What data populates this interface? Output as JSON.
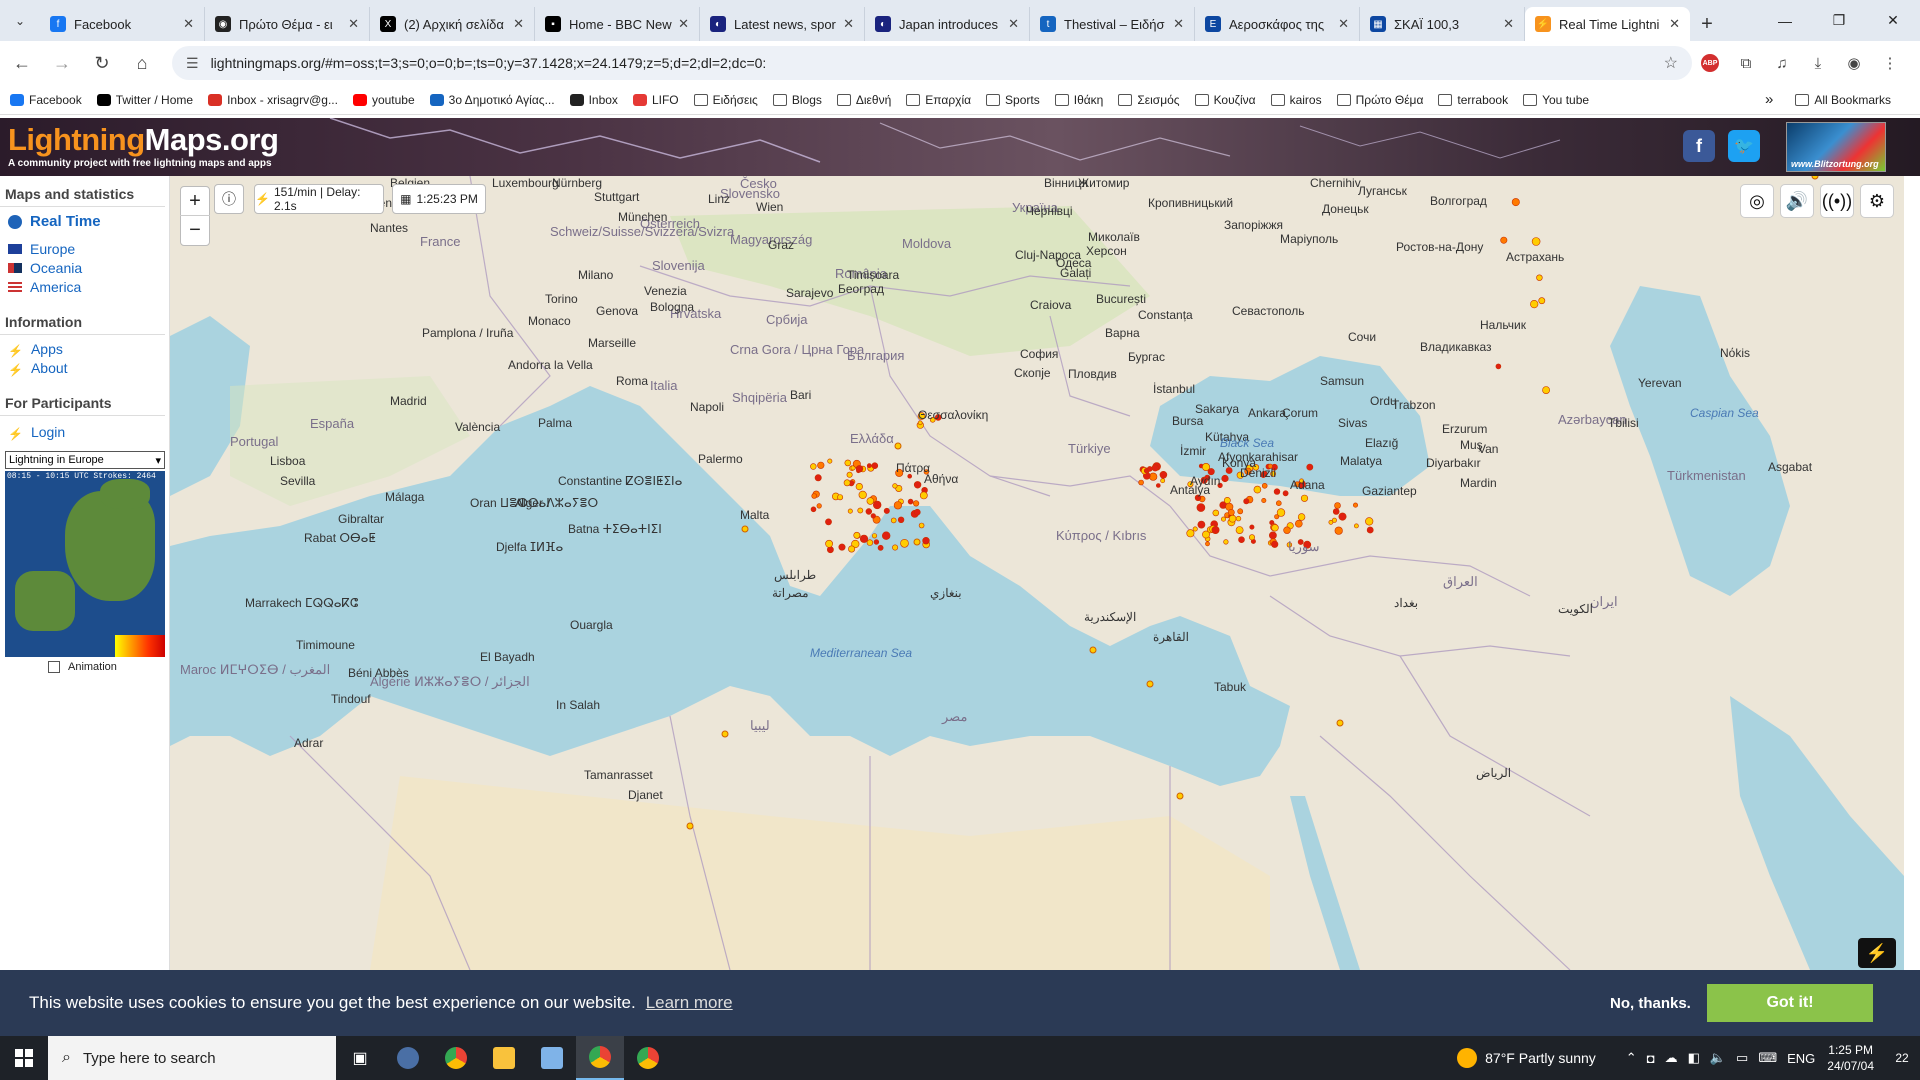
{
  "browser": {
    "tabs": [
      {
        "title": "Facebook",
        "color": "#1877f2",
        "glyph": "f"
      },
      {
        "title": "Πρώτο Θέμα - ει",
        "color": "#222222",
        "glyph": "◉"
      },
      {
        "title": "(2) Αρχική σελίδα",
        "color": "#000000",
        "glyph": "X"
      },
      {
        "title": "Home - BBC New",
        "color": "#000000",
        "glyph": "▪"
      },
      {
        "title": "Latest news, spor",
        "color": "#1a237e",
        "glyph": "◐"
      },
      {
        "title": "Japan introduces",
        "color": "#1a237e",
        "glyph": "◐"
      },
      {
        "title": "Thestival – Ειδήσ",
        "color": "#1565c0",
        "glyph": "t"
      },
      {
        "title": "Αεροσκάφος της",
        "color": "#0d47a1",
        "glyph": "E"
      },
      {
        "title": "ΣΚΑΪ 100,3",
        "color": "#0d47a1",
        "glyph": "▦"
      },
      {
        "title": "Real Time Lightni",
        "color": "#f7931e",
        "glyph": "⚡",
        "active": true
      }
    ],
    "url": "lightningmaps.org/#m=oss;t=3;s=0;o=0;b=;ts=0;y=37.1428;x=24.1479;z=5;d=2;dl=2;dc=0:",
    "bookmarks": [
      {
        "label": "Facebook",
        "type": "site",
        "color": "#1877f2"
      },
      {
        "label": "Twitter / Home",
        "type": "site",
        "color": "#000000"
      },
      {
        "label": "Inbox - xrisagrv@g...",
        "type": "site",
        "color": "#d93025"
      },
      {
        "label": "youtube",
        "type": "site",
        "color": "#ff0000"
      },
      {
        "label": "3ο Δημοτικό Αγίας...",
        "type": "site",
        "color": "#1565c0"
      },
      {
        "label": "Inbox",
        "type": "site",
        "color": "#222222"
      },
      {
        "label": "LIFO",
        "type": "site",
        "color": "#e53935"
      },
      {
        "label": "Ειδήσεις",
        "type": "folder"
      },
      {
        "label": "Blogs",
        "type": "folder"
      },
      {
        "label": "Διεθνή",
        "type": "folder"
      },
      {
        "label": "Επαρχία",
        "type": "folder"
      },
      {
        "label": "Sports",
        "type": "folder"
      },
      {
        "label": "Ιθάκη",
        "type": "folder"
      },
      {
        "label": "Σεισμός",
        "type": "folder"
      },
      {
        "label": "Κουζίνα",
        "type": "folder"
      },
      {
        "label": "kairos",
        "type": "folder"
      },
      {
        "label": "Πρώτο Θέμα",
        "type": "folder"
      },
      {
        "label": "terrabook",
        "type": "folder"
      },
      {
        "label": "You tube",
        "type": "folder"
      }
    ],
    "all_bookmarks": "All Bookmarks",
    "more": "»"
  },
  "site": {
    "logo_lightning": "Lightning",
    "logo_maps": "Maps.org",
    "tagline": "A community project with free lightning maps and apps",
    "blitz_badge": "www.Blitzortung.org"
  },
  "sidebar": {
    "maps_header": "Maps and statistics",
    "realtime": "Real Time",
    "regions": [
      "Europe",
      "Oceania",
      "America"
    ],
    "info_header": "Information",
    "info_items": [
      "Apps",
      "About"
    ],
    "participants_header": "For Participants",
    "login": "Login",
    "select_value": "Lightning in Europe",
    "mini_caption": "08:15 - 10:15 UTC Strokes: 2464",
    "animation_label": "Animation"
  },
  "map": {
    "zoom_in": "+",
    "zoom_out": "−",
    "rate": "151/min | Delay: 2.1s",
    "time": "1:25:23 PM",
    "labels_country": [
      {
        "t": "France"
      },
      {
        "t": "España"
      },
      {
        "t": "Portugal"
      },
      {
        "t": "Italia"
      },
      {
        "t": "Magyarország"
      },
      {
        "t": "România"
      },
      {
        "t": "Україна"
      },
      {
        "t": "Türkiye"
      },
      {
        "t": "Moldova"
      },
      {
        "t": "Србија"
      },
      {
        "t": "България"
      },
      {
        "t": "Ελλάδα"
      },
      {
        "t": "Slovenija"
      },
      {
        "t": "Hrvatska"
      },
      {
        "t": "Shqipëria"
      },
      {
        "t": "Crna Gora / Црна Гора"
      },
      {
        "t": "Algérie ⵍⵣⵣⴰⵢⴻⵔ / الجزائر"
      },
      {
        "t": "مصر"
      },
      {
        "t": "ليبيا"
      },
      {
        "t": "العراق"
      },
      {
        "t": "Azərbaycan"
      },
      {
        "t": "Türkmenistan"
      },
      {
        "t": "ایران"
      },
      {
        "t": "Maroc ⵍⵎⵖⵔⵉⴱ / المغرب"
      },
      {
        "t": "سوريا"
      },
      {
        "t": "Κύπρος / Kıbrıs"
      },
      {
        "t": "Österreich"
      },
      {
        "t": "Schweiz/Suisse/Svizzera/Svizra"
      },
      {
        "t": "Slovensko"
      },
      {
        "t": "Česko"
      }
    ],
    "labels_city": [
      {
        "t": "Belgien"
      },
      {
        "t": "Nürnberg"
      },
      {
        "t": "Luxembourg"
      },
      {
        "t": "Stuttgart"
      },
      {
        "t": "München"
      },
      {
        "t": "Linz"
      },
      {
        "t": "Wien"
      },
      {
        "t": "Graz"
      },
      {
        "t": "Rennes"
      },
      {
        "t": "Nantes"
      },
      {
        "t": "Milano"
      },
      {
        "t": "Torino"
      },
      {
        "t": "Venezia"
      },
      {
        "t": "Genova"
      },
      {
        "t": "Bologna"
      },
      {
        "t": "Monaco"
      },
      {
        "t": "Marseille"
      },
      {
        "t": "Pamplona / Iruña"
      },
      {
        "t": "Andorra la Vella"
      },
      {
        "t": "Madrid"
      },
      {
        "t": "València"
      },
      {
        "t": "Palma"
      },
      {
        "t": "Lisboa"
      },
      {
        "t": "Sevilla"
      },
      {
        "t": "Málaga"
      },
      {
        "t": "Gibraltar"
      },
      {
        "t": "Roma"
      },
      {
        "t": "Napoli"
      },
      {
        "t": "Bari"
      },
      {
        "t": "Palermo"
      },
      {
        "t": "Sarajevo"
      },
      {
        "t": "Београд"
      },
      {
        "t": "Timișoara"
      },
      {
        "t": "Cluj-Napoca"
      },
      {
        "t": "Craiova"
      },
      {
        "t": "București"
      },
      {
        "t": "Constanța"
      },
      {
        "t": "Варна"
      },
      {
        "t": "София"
      },
      {
        "t": "Бургас"
      },
      {
        "t": "Пловдив"
      },
      {
        "t": "Скопје"
      },
      {
        "t": "Θεσσαλονίκη"
      },
      {
        "t": "Πάτρα"
      },
      {
        "t": "Αθήνα"
      },
      {
        "t": "İstanbul"
      },
      {
        "t": "Bursa"
      },
      {
        "t": "Sakarya"
      },
      {
        "t": "Ankara"
      },
      {
        "t": "Çorum"
      },
      {
        "t": "Samsun"
      },
      {
        "t": "İzmir"
      },
      {
        "t": "Kütahya"
      },
      {
        "t": "Afyonkarahisar"
      },
      {
        "t": "Konya"
      },
      {
        "t": "Denizli"
      },
      {
        "t": "Aydın"
      },
      {
        "t": "Antalya"
      },
      {
        "t": "Adana"
      },
      {
        "t": "Gaziantep"
      },
      {
        "t": "Malatya"
      },
      {
        "t": "Elazığ"
      },
      {
        "t": "Sivas"
      },
      {
        "t": "Ordu"
      },
      {
        "t": "Trabzon"
      },
      {
        "t": "Erzurum"
      },
      {
        "t": "Muş"
      },
      {
        "t": "Van"
      },
      {
        "t": "Diyarbakır"
      },
      {
        "t": "Mardin"
      },
      {
        "t": "Одеса"
      },
      {
        "t": "Миколаїв"
      },
      {
        "t": "Херсон"
      },
      {
        "t": "Запоріжжя"
      },
      {
        "t": "Маріуполь"
      },
      {
        "t": "Донецьк"
      },
      {
        "t": "Луганськ"
      },
      {
        "t": "Волгоград"
      },
      {
        "t": "Ростов-на-Дону"
      },
      {
        "t": "Астрахань"
      },
      {
        "t": "Севастополь"
      },
      {
        "t": "Сочи"
      },
      {
        "t": "Нальчик"
      },
      {
        "t": "Владикавказ"
      },
      {
        "t": "Кропивницький"
      },
      {
        "t": "Житомир"
      },
      {
        "t": "Вінниця"
      },
      {
        "t": "Чернівці"
      },
      {
        "t": "Galați"
      },
      {
        "t": "Chernihiv"
      },
      {
        "t": "Oran ⵡⴻⵀⵔⴰⵏ"
      },
      {
        "t": "Alger ⴷⵣⴰⵢⴻⵔ"
      },
      {
        "t": "Constantine ⵇⵙⴻⵏⵟⵉⵏⴰ"
      },
      {
        "t": "Batna ⵜⵉⴱⴰⵜⵏⵉⵏ"
      },
      {
        "t": "Djelfa ⵊⵍⴼⴰ"
      },
      {
        "t": "Rabat ⵔⴱⴰⵟ"
      },
      {
        "t": "Marrakech ⵎⵕⵕⴰⴽⵛ"
      },
      {
        "t": "Malta"
      },
      {
        "t": "بنغازي"
      },
      {
        "t": "طرابلس"
      },
      {
        "t": "مصراتة"
      },
      {
        "t": "الإسكندرية"
      },
      {
        "t": "القاهرة"
      },
      {
        "t": "Nόkis"
      },
      {
        "t": "Asgabat"
      },
      {
        "t": "Tbilisi"
      },
      {
        "t": "Yerevan"
      },
      {
        "t": "بغداد"
      },
      {
        "t": "الكويت"
      },
      {
        "t": "الرياض"
      },
      {
        "t": "Tabuk"
      },
      {
        "t": "In Salah"
      },
      {
        "t": "Ouargla"
      },
      {
        "t": "El Bayadh"
      },
      {
        "t": "Béni Abbès"
      },
      {
        "t": "Tamanrasset"
      },
      {
        "t": "Djanet"
      },
      {
        "t": "Tindouf"
      },
      {
        "t": "Adrar"
      },
      {
        "t": "Timimoune"
      }
    ],
    "labels_sea": [
      {
        "t": "Mediterranean Sea"
      },
      {
        "t": "Black Sea"
      },
      {
        "t": "Caspian Sea"
      }
    ]
  },
  "cookie": {
    "message": "This website uses cookies to ensure you get the best experience on our website.",
    "learn_more": "Learn more",
    "decline": "No, thanks.",
    "accept": "Got it!"
  },
  "taskbar": {
    "search_placeholder": "Type here to search",
    "weather": "87°F  Partly sunny",
    "lang": "ENG",
    "time": "1:25 PM",
    "date": "24/07/04",
    "notifications": "22"
  }
}
